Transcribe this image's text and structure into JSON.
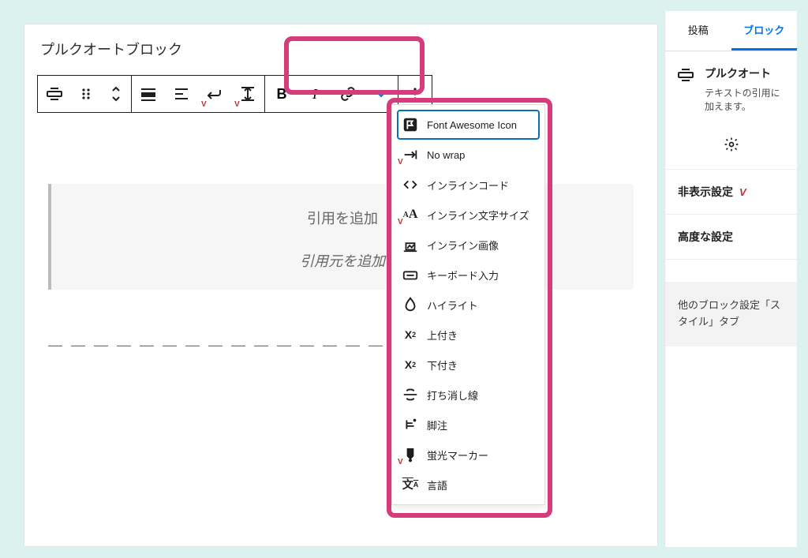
{
  "block_title": "プルクオートブロック",
  "quote": {
    "add_label": "引用を追加",
    "source_label": "引用元を追加"
  },
  "dashes": "— — — — — — — — — — — — — — — — — — —",
  "toolbar": {
    "tooltips": {
      "align": "align",
      "drag": "drag-handle",
      "move": "move-arrows",
      "fill": "style-fill",
      "style2": "style-outline",
      "vk1": "vk-option-1",
      "vk2": "vk-option-2",
      "bold": "B",
      "italic": "I",
      "link": "link",
      "more_text": "more-text-formats",
      "options": "options"
    }
  },
  "dropdown": [
    {
      "id": "font-awesome-icon",
      "label": "Font Awesome Icon",
      "icon": "flag",
      "selected": true,
      "vk": false
    },
    {
      "id": "no-wrap",
      "label": "No wrap",
      "icon": "nowrap",
      "vk": true
    },
    {
      "id": "inline-code",
      "label": "インラインコード",
      "icon": "code",
      "vk": false
    },
    {
      "id": "inline-font-size",
      "label": "インライン文字サイズ",
      "icon": "fontsize",
      "vk": true
    },
    {
      "id": "inline-image",
      "label": "インライン画像",
      "icon": "img",
      "vk": false
    },
    {
      "id": "keyboard-input",
      "label": "キーボード入力",
      "icon": "kbd",
      "vk": false
    },
    {
      "id": "highlight",
      "label": "ハイライト",
      "icon": "drop",
      "vk": false
    },
    {
      "id": "superscript",
      "label": "上付き",
      "icon": "sup",
      "vk": false
    },
    {
      "id": "subscript",
      "label": "下付き",
      "icon": "sub",
      "vk": false
    },
    {
      "id": "strikethrough",
      "label": "打ち消し線",
      "icon": "strike",
      "vk": false
    },
    {
      "id": "footnote",
      "label": "脚注",
      "icon": "foot",
      "vk": false
    },
    {
      "id": "highlighter",
      "label": "蛍光マーカー",
      "icon": "marker",
      "vk": true
    },
    {
      "id": "language",
      "label": "言語",
      "icon": "lang",
      "vk": false
    }
  ],
  "sidebar": {
    "tabs": {
      "post": "投稿",
      "block": "ブロック"
    },
    "block": {
      "title": "プルクオート",
      "desc": "テキストの引用に加えます。"
    },
    "sections": {
      "hidden": "非表示設定",
      "advanced": "高度な設定"
    },
    "notice": "他のブロック設定「スタイル」タブ"
  }
}
